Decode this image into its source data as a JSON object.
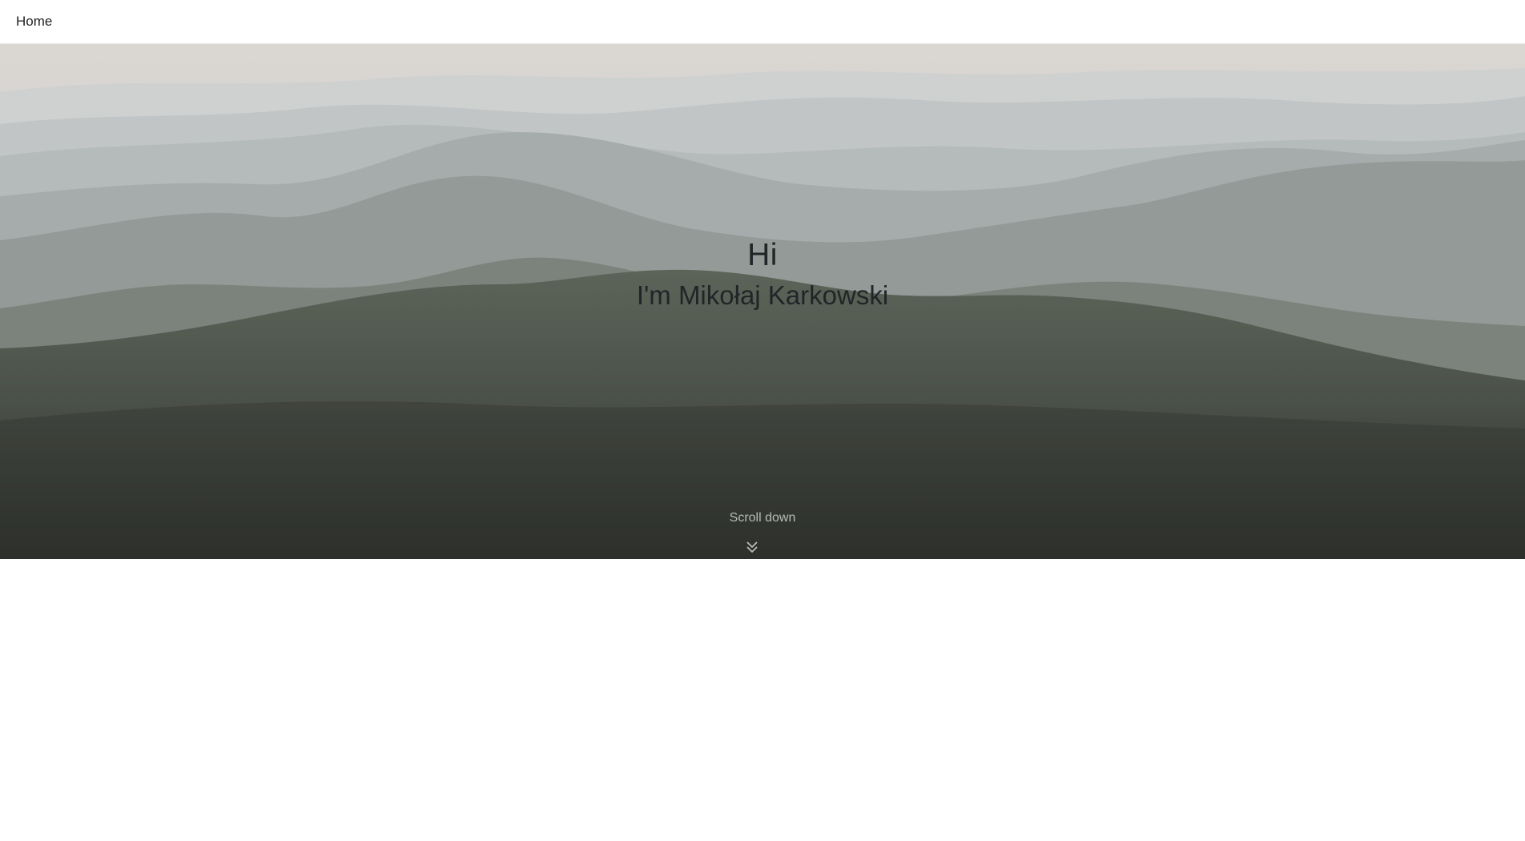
{
  "nav": {
    "home_label": "Home"
  },
  "hero": {
    "greeting": "Hi",
    "name_line": "I'm Mikołaj Karkowski",
    "scroll_label": "Scroll down",
    "scroll_icon": "double-chevron-down-icon"
  },
  "colors": {
    "nav_background": "#ffffff",
    "hero_text": "#222528",
    "scroll_text": "#b8bbb8",
    "page_background": "#ffffff"
  }
}
